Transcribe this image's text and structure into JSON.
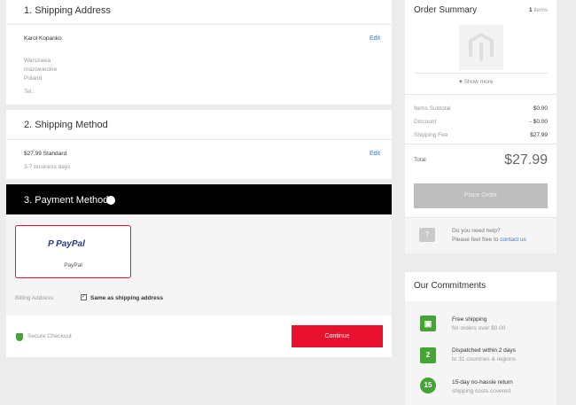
{
  "shipping_address": {
    "title": "1. Shipping Address",
    "edit": "Edit",
    "name": "Karol Kopanko",
    "city": "Warszawa",
    "region": "mazowieckie",
    "country": "Poland",
    "tel": "Tel.:"
  },
  "shipping_method": {
    "title": "2. Shipping Method",
    "edit": "Edit",
    "rate": "$27.99 Standard",
    "days": "3-7 business days"
  },
  "payment": {
    "title": "3. Payment Method",
    "method_brand": "PayPal",
    "method_label": "PayPal",
    "billing_label": "Billing Address:",
    "same_as_shipping": "Same as shipping address",
    "secure_checkout": "Secure Checkout",
    "continue": "Continue"
  },
  "order_summary": {
    "title": "Order Summary",
    "count": "1",
    "count_unit": "items",
    "show_more": "Show more",
    "rows": [
      {
        "label": "Items Subtotal",
        "value": "$0.00"
      },
      {
        "label": "Discount",
        "value": "- $0.00"
      },
      {
        "label": "Shipping Fee",
        "value": "$27.99"
      }
    ],
    "total_label": "Total",
    "total_value": "$27.99",
    "place_order": "Place Order",
    "help_q": "Do you need help?",
    "help_prefix": "Please feel free to ",
    "help_link": "contact us"
  },
  "commitments": {
    "title": "Our Commitments",
    "items": [
      {
        "title": "Free shipping",
        "sub": "for orders over $0.00",
        "icon_text": ""
      },
      {
        "title": "Dispatched within 2 days",
        "sub": "to 31 countries & regions",
        "icon_text": "2"
      },
      {
        "title": "15-day no-hassle return",
        "sub": "shipping costs covered",
        "icon_text": "15"
      }
    ]
  },
  "colors": {
    "accent_red": "#e8112d",
    "green": "#46a335",
    "link_blue": "#3b7ac7",
    "paypal_dark": "#253b80",
    "paypal_light": "#179bd7"
  }
}
